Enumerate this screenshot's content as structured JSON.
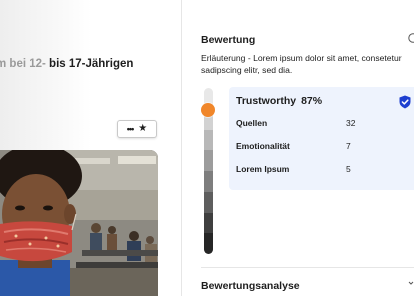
{
  "article": {
    "title_faded": "m bei 12-",
    "title_rest": " bis 17-Jährigen",
    "actions": {
      "more_icon": "ellipsis-icon",
      "favorite_icon": "star-icon"
    },
    "image_subject": "teenager wearing a red patterned face mask in a waiting hall"
  },
  "rating": {
    "title": "Bewertung",
    "help_icon": "help-icon",
    "description": "Erläuterung - Lorem ipsum dolor sit amet, consetetur sadipscing elitr, sed dia.",
    "scale": {
      "colors": [
        "#e8e8e8",
        "#d2d2d2",
        "#b8b8b8",
        "#9c9c9c",
        "#7e7e7e",
        "#5e5e5e",
        "#3f3f3f",
        "#262626"
      ],
      "knob_color": "#f0862a"
    },
    "card": {
      "label": "Trustworthy",
      "percent": "87%",
      "badge_icon": "shield-check-icon",
      "badge_color": "#1e3fd0",
      "metrics": [
        {
          "label": "Quellen",
          "value": "32"
        },
        {
          "label": "Emotionalität",
          "value": "7"
        },
        {
          "label": "Lorem Ipsum",
          "value": "5"
        }
      ]
    }
  },
  "analysis": {
    "title": "Bewertungsanalyse"
  }
}
